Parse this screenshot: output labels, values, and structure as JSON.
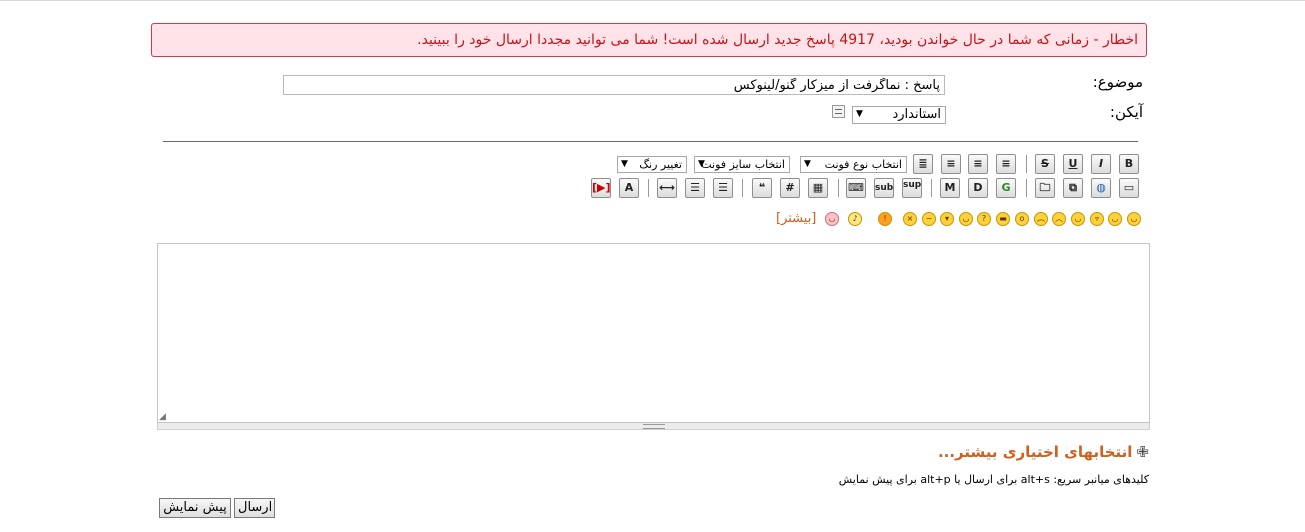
{
  "warning": {
    "text": "اخطار - زمانی که شما در حال خواندن بودید، 4917 پاسخ جدید ارسال شده است! شما می توانید مجددا ارسال خود را ببینید."
  },
  "form": {
    "subject_label": "موضوع:",
    "subject_value": "پاسخ : نماگرفت از میزکار گنو/لینوکس",
    "icon_label": "آیکن:",
    "icon_select": "استاندارد"
  },
  "toolbar": {
    "color_select": "تغییر رنگ",
    "size_select": "انتخاب سایز فونت",
    "font_select": "انتخاب نوع فونت",
    "bold": "B",
    "italic": "I",
    "underline": "U",
    "strike": "S",
    "sub": "sub",
    "sup": "sup",
    "code": "#",
    "glow": "G",
    "shadow": "D",
    "marquee": "M"
  },
  "smileys": {
    "more_link": "[بیشتر]"
  },
  "options": {
    "more_options": "انتخابهای اختیاری بیشتر..."
  },
  "shortcuts": {
    "text": "کلیدهای میانبر سریع: alt+s برای ارسال یا alt+p برای پیش نمایش"
  },
  "buttons": {
    "submit": "ارسال",
    "preview": "پیش نمایش"
  }
}
